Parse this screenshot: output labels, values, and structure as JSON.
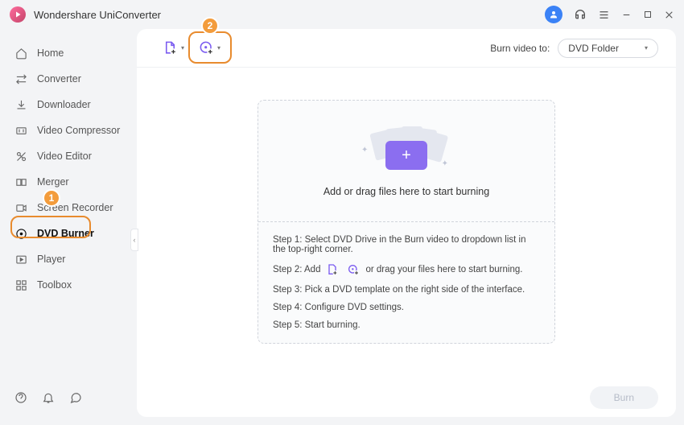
{
  "app": {
    "title": "Wondershare UniConverter"
  },
  "sidebar": {
    "items": [
      {
        "label": "Home"
      },
      {
        "label": "Converter"
      },
      {
        "label": "Downloader"
      },
      {
        "label": "Video Compressor"
      },
      {
        "label": "Video Editor"
      },
      {
        "label": "Merger"
      },
      {
        "label": "Screen Recorder"
      },
      {
        "label": "DVD Burner"
      },
      {
        "label": "Player"
      },
      {
        "label": "Toolbox"
      }
    ]
  },
  "toolbar": {
    "burn_to_label": "Burn video to:",
    "burn_to_value": "DVD Folder"
  },
  "drop": {
    "title": "Add or drag files here to start burning"
  },
  "steps": {
    "s1_a": "Step 1: Select DVD Drive in the Burn video to dropdown list in the top-right corner.",
    "s2_a": "Step 2: Add",
    "s2_b": "or drag your files here to start burning.",
    "s3": "Step 3: Pick a DVD template on the right side of the interface.",
    "s4": "Step 4: Configure DVD settings.",
    "s5": "Step 5: Start burning."
  },
  "footer": {
    "burn_label": "Burn"
  },
  "annotations": {
    "badge1": "1",
    "badge2": "2"
  }
}
